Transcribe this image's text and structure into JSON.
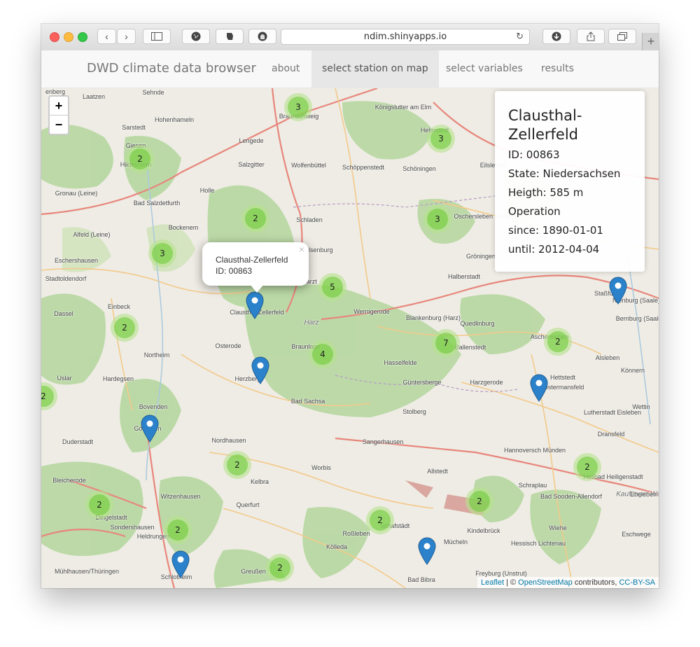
{
  "browser": {
    "url": "ndim.shinyapps.io",
    "new_tab": "+"
  },
  "navbar": {
    "brand": "DWD climate data browser",
    "items": [
      {
        "label": "about"
      },
      {
        "label": "select station on map"
      },
      {
        "label": "select variables"
      },
      {
        "label": "results"
      }
    ],
    "active": "select station on map"
  },
  "map": {
    "zoom_in": "+",
    "zoom_out": "−",
    "place_labels": [
      "enberg",
      "Laatzen",
      "Sehnde",
      "Braunschweig",
      "Königslutter am Elm",
      "Helmstedt",
      "Sarstedt",
      "Hohenhameln",
      "Lengede",
      "Giesen",
      "Hildesheim",
      "Salzgitter",
      "Wolfenbüttel",
      "Schöppenstedt",
      "Schöningen",
      "Eilsleben",
      "Gronau (Leine)",
      "Holle",
      "Bad Salzdetfurth",
      "Bockenem",
      "Schladen",
      "Oschersleben (Bode)",
      "Alfeld (Leine)",
      "Ilsenburg",
      "Gröningen",
      "Eschershausen",
      "Stadtoldendorf",
      "Harzt",
      "Halberstadt",
      "Staßfurt",
      "Nienburg (Saale)",
      "Bernburg (Saale)",
      "Dassel",
      "Einbeck",
      "Clausthal-Zellerfeld",
      "Wernigerode",
      "Harz",
      "Blankenburg (Harz)",
      "Quedlinburg",
      "Osterode",
      "Braunlage",
      "Ballenstedt",
      "Aschersleben",
      "Alsleben",
      "Northeim",
      "Hasselfelde",
      "Hettstedt",
      "Könnern",
      "Uslar",
      "Hardegsen",
      "Herzberg",
      "Güntersberge",
      "Harzgerode",
      "Klostermansfeld",
      "Bad Sachsa",
      "Stolberg",
      "Wettin",
      "Bovenden",
      "Göttingen",
      "Lutherstadt Eisleben",
      "Dransfeld",
      "Duderstadt",
      "Nordhausen",
      "Sangerhausen",
      "Hannoversch Münden",
      "Bleicherode",
      "Worbis",
      "Kelbra",
      "Allstedt",
      "Schraplau",
      "Heilbad Heiligenstadt",
      "Kaufunger Wald",
      "Witzenhausen",
      "Dingelstadt",
      "Sondershausen",
      "Querfurt",
      "Schafstädt",
      "Bad Sooden-Allendorf",
      "Ebeleben",
      "Heldrungen",
      "Roßleben",
      "Kindelbrück",
      "Wiehe",
      "Mücheln",
      "Hessisch Lichtenau",
      "Eschwege",
      "Mühlhausen/Thüringen",
      "Schlotheim",
      "Greußen",
      "Kölleda",
      "Bad Bibra",
      "Freyburg (Unstrut)"
    ],
    "clusters": [
      {
        "count": "3"
      },
      {
        "count": "3"
      },
      {
        "count": "2"
      },
      {
        "count": "2"
      },
      {
        "count": "3"
      },
      {
        "count": "3"
      },
      {
        "count": "5"
      },
      {
        "count": "2"
      },
      {
        "count": "7"
      },
      {
        "count": "2"
      },
      {
        "count": "4"
      },
      {
        "count": "2"
      },
      {
        "count": "2"
      },
      {
        "count": "2"
      },
      {
        "count": "2"
      },
      {
        "count": "2"
      },
      {
        "count": "2"
      },
      {
        "count": "2"
      },
      {
        "count": "2"
      }
    ],
    "popup": {
      "name": "Clausthal-Zellerfeld",
      "id_line": "ID: 00863",
      "close": "×"
    },
    "attribution": {
      "leaflet": "Leaflet",
      "sep": " | © ",
      "osm": "OpenStreetMap",
      "contrib": " contributors, ",
      "license": "CC-BY-SA"
    }
  },
  "info_panel": {
    "title": "Clausthal-Zellerfeld",
    "id": "ID: 00863",
    "state": "State: Niedersachsen",
    "height": "Heigth: 585 m",
    "operation": "Operation",
    "since": "since: 1890-01-01",
    "until": "until: 2012-04-04"
  },
  "colors": {
    "cluster_outer": "#b5e28c",
    "cluster_inner": "#6ecc39",
    "marker": "#2b82cb",
    "forest": "#a9d08a",
    "road_major": "#e8867c",
    "road_secondary": "#f4c98a"
  }
}
